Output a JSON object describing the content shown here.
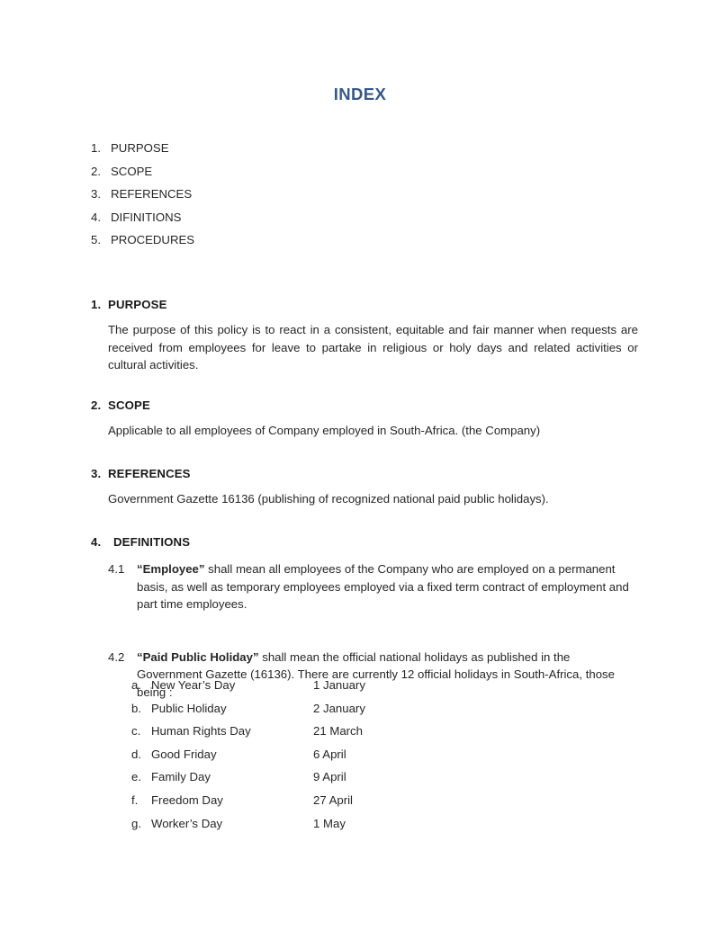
{
  "document": {
    "title": "INDEX",
    "title_color": "#36598a"
  },
  "index": {
    "items": [
      {
        "num": "1.",
        "label": "PURPOSE"
      },
      {
        "num": "2.",
        "label": "SCOPE"
      },
      {
        "num": "3.",
        "label": "REFERENCES"
      },
      {
        "num": "4.",
        "label": "DIFINITIONS"
      },
      {
        "num": "5.",
        "label": "PROCEDURES"
      }
    ]
  },
  "sections": {
    "purpose": {
      "num": "1.",
      "heading": "PURPOSE",
      "body": "The purpose of this policy is to react in a consistent, equitable and fair manner when requests are received from employees for leave to partake in religious or holy days and related activities or cultural activities."
    },
    "scope": {
      "num": "2.",
      "heading": "SCOPE",
      "body": "Applicable to all employees of Company employed in South-Africa. (the Company)"
    },
    "references": {
      "num": "3.",
      "heading": "REFERENCES",
      "body": "Government Gazette 16136 (publishing of recognized national paid public holidays)."
    },
    "definitions": {
      "num": "4.",
      "heading": "DEFINITIONS",
      "clause_4_1": {
        "num": "4.1",
        "term": "“Employee”",
        "text": " shall mean all employees of the Company who are employed on a permanent basis, as well as temporary employees employed via a fixed term contract of employment and part time employees."
      },
      "clause_4_2": {
        "num": "4.2",
        "term": "“Paid Public Holiday”",
        "text": " shall mean the official national holidays as published in the Government Gazette (16136).  There are currently 12 official holidays in South-Africa, those being :"
      }
    }
  },
  "holidays": {
    "rows": [
      {
        "letter": "a.",
        "name": "New Year’s Day",
        "date": "1 January"
      },
      {
        "letter": "b.",
        "name": "Public Holiday",
        "date": "2 January"
      },
      {
        "letter": "c.",
        "name": "Human Rights Day",
        "date": "21 March"
      },
      {
        "letter": "d.",
        "name": "Good Friday",
        "date": "6 April"
      },
      {
        "letter": "e.",
        "name": "Family Day",
        "date": "9 April"
      },
      {
        "letter": "f.",
        "name": "Freedom Day",
        "date": "27 April"
      },
      {
        "letter": "g.",
        "name": "Worker’s Day",
        "date": "1 May"
      }
    ]
  }
}
